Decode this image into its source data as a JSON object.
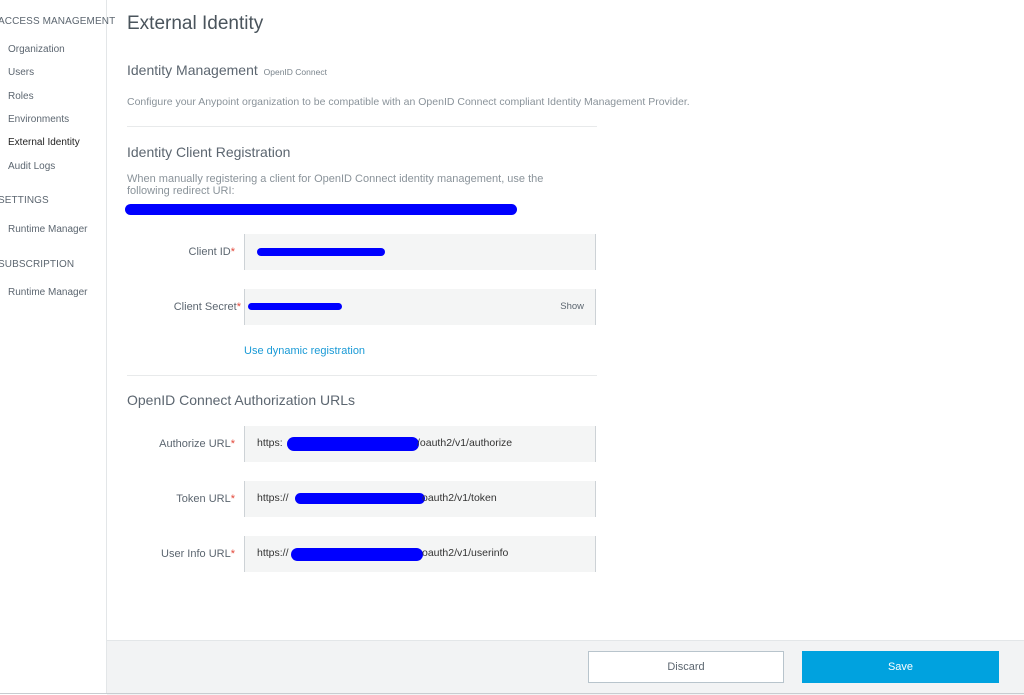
{
  "sidebar": {
    "sections": [
      {
        "title": "ACCESS MANAGEMENT",
        "items": [
          "Organization",
          "Users",
          "Roles",
          "Environments",
          "External Identity",
          "Audit Logs"
        ]
      },
      {
        "title": "SETTINGS",
        "items": [
          "Runtime Manager"
        ]
      },
      {
        "title": "SUBSCRIPTION",
        "items": [
          "Runtime Manager"
        ]
      }
    ],
    "active_item": "External Identity"
  },
  "page": {
    "title": "External Identity",
    "identity_management": {
      "heading": "Identity Management",
      "subheading": "OpenID Connect",
      "description": "Configure your Anypoint organization to be compatible with an OpenID Connect compliant Identity Management Provider."
    },
    "client_registration": {
      "heading": "Identity Client Registration",
      "note": "When manually registering a client for OpenID Connect identity management, use the following redirect URI:",
      "client_id_label": "Client ID",
      "client_secret_label": "Client Secret",
      "show_label": "Show",
      "required_mark": "*",
      "dynamic_link": "Use dynamic registration"
    },
    "authorization_urls": {
      "heading": "OpenID Connect Authorization URLs",
      "authorize_label": "Authorize URL",
      "authorize_prefix": "https:",
      "authorize_suffix": "/oauth2/v1/authorize",
      "token_label": "Token URL",
      "token_prefix": "https://",
      "token_suffix": "oauth2/v1/token",
      "userinfo_label": "User Info URL",
      "userinfo_prefix": "https://",
      "userinfo_suffix": "oauth2/v1/userinfo"
    }
  },
  "footer": {
    "discard_label": "Discard",
    "save_label": "Save"
  },
  "colors": {
    "accent": "#00a2df",
    "link": "#1a9ad6",
    "required": "#e3483a",
    "redaction": "#0000ff"
  }
}
